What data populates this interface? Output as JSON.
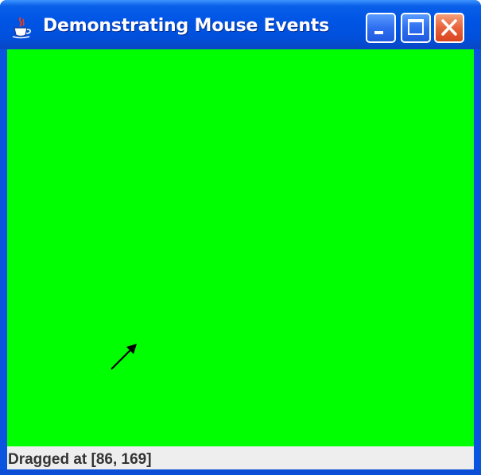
{
  "window": {
    "title": "Demonstrating Mouse Events",
    "icon": "java-coffee-cup-icon",
    "controls": {
      "minimize_icon": "minimize-icon",
      "maximize_icon": "maximize-icon",
      "close_icon": "close-icon"
    }
  },
  "canvas": {
    "background_color": "#00ff00",
    "cursor_icon": "arrow-cursor-icon"
  },
  "statusbar": {
    "text": "Dragged at [86, 169]"
  },
  "colors": {
    "titlebar": "#0055e5",
    "close_button": "#e8623a",
    "canvas": "#00ff00",
    "statusbar": "#eeeeee"
  }
}
